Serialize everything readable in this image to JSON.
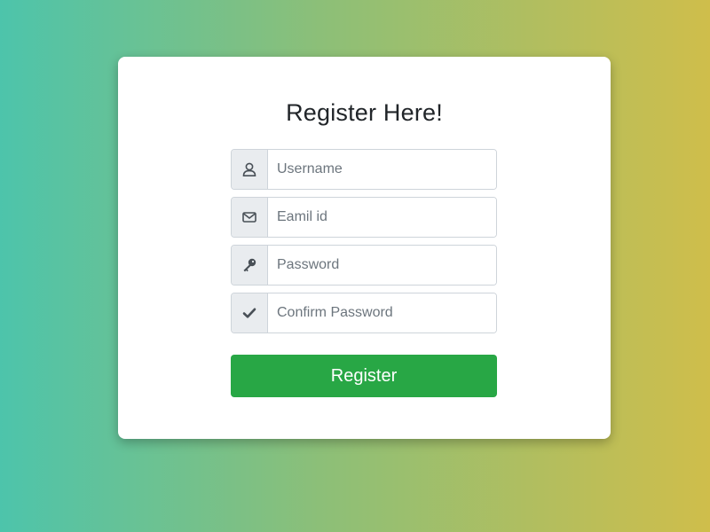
{
  "form": {
    "title": "Register Here!",
    "fields": [
      {
        "icon": "user-icon",
        "placeholder": "Username",
        "value": ""
      },
      {
        "icon": "envelope-icon",
        "placeholder": "Eamil id",
        "value": ""
      },
      {
        "icon": "key-icon",
        "placeholder": "Password",
        "value": ""
      },
      {
        "icon": "check-icon",
        "placeholder": "Confirm Password",
        "value": ""
      }
    ],
    "submit_label": "Register"
  },
  "colors": {
    "gradient_start": "#4dc4ab",
    "gradient_end": "#cfbe4b",
    "button": "#28a745",
    "addon_bg": "#e9ecef"
  }
}
